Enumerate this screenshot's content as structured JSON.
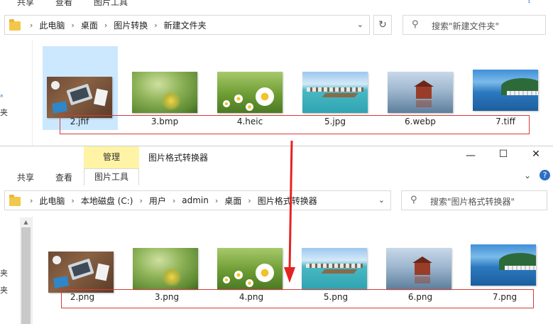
{
  "window1": {
    "ribbon_tabs": [
      "共享",
      "查看",
      "图片工具"
    ],
    "address": [
      "此电脑",
      "桌面",
      "图片转换",
      "新建文件夹"
    ],
    "search_placeholder": "搜索\"新建文件夹\"",
    "nav_fragments": [
      "夹",
      "夹"
    ],
    "files": [
      {
        "name": "2.jfif",
        "thumb": "desk"
      },
      {
        "name": "3.bmp",
        "thumb": "bmp"
      },
      {
        "name": "4.heic",
        "thumb": "heic"
      },
      {
        "name": "5.jpg",
        "thumb": "jpg"
      },
      {
        "name": "6.webp",
        "thumb": "webp"
      },
      {
        "name": "7.tiff",
        "thumb": "tiff"
      }
    ]
  },
  "window2": {
    "manage_tab": "管理",
    "title": "图片格式转换器",
    "ribbon_tabs": [
      "共享",
      "查看",
      "图片工具"
    ],
    "address": [
      "此电脑",
      "本地磁盘 (C:)",
      "用户",
      "admin",
      "桌面",
      "图片格式转换器"
    ],
    "search_placeholder": "搜索\"图片格式转换器\"",
    "nav_fragments": [
      "夹",
      "夹"
    ],
    "files": [
      {
        "name": "2.png",
        "thumb": "desk"
      },
      {
        "name": "3.png",
        "thumb": "bmp"
      },
      {
        "name": "4.png",
        "thumb": "heic"
      },
      {
        "name": "5.png",
        "thumb": "jpg"
      },
      {
        "name": "6.png",
        "thumb": "webp"
      },
      {
        "name": "7.png",
        "thumb": "tiff"
      }
    ]
  },
  "colors": {
    "highlight_box": "#d63a3a",
    "selection": "#cce8ff",
    "manage_tab_bg": "#fff3a6"
  }
}
